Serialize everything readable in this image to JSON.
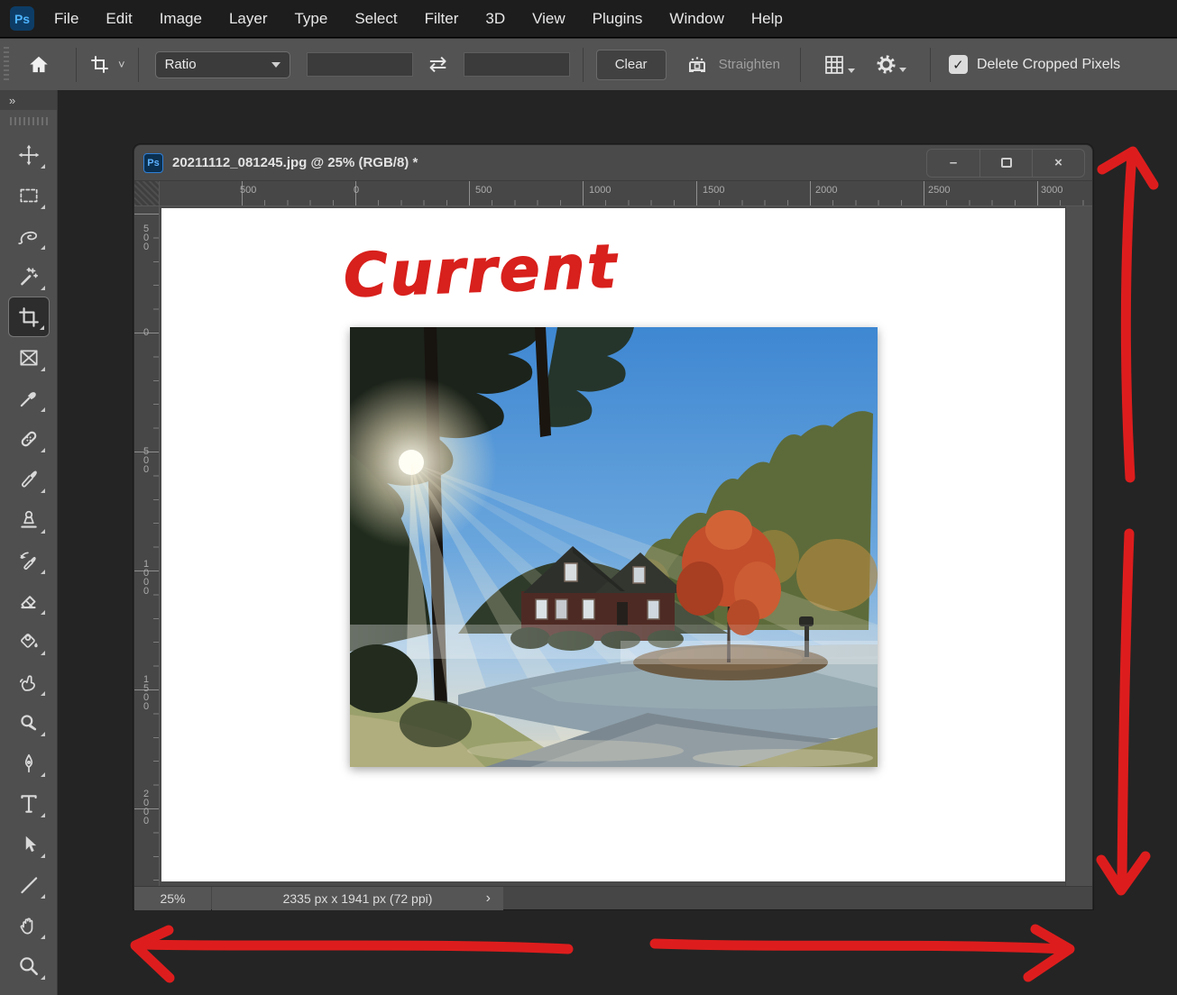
{
  "app": {
    "logo": "Ps",
    "theme_bg": "#242424",
    "panel_bg": "#535353",
    "annotation_color": "#dd1d1d"
  },
  "menubar": {
    "items": [
      "File",
      "Edit",
      "Image",
      "Layer",
      "Type",
      "Select",
      "Filter",
      "3D",
      "View",
      "Plugins",
      "Window",
      "Help"
    ]
  },
  "optionsbar": {
    "ratio_label": "Ratio",
    "width_value": "",
    "height_value": "",
    "swap_glyph": "⇄",
    "clear_label": "Clear",
    "straighten_label": "Straighten",
    "check_glyph": "✓",
    "delete_cropped_label": "Delete Cropped Pixels",
    "delete_cropped_checked": true,
    "icons": [
      "home-icon",
      "crop-tool-icon",
      "swap-icon",
      "straighten-icon",
      "grid-overlay-icon",
      "gear-icon",
      "checkbox"
    ]
  },
  "toolbar": {
    "expand_glyph": "»",
    "selected_tool": "crop",
    "tools": [
      "move",
      "rectangular-marquee",
      "lasso",
      "magic-wand",
      "crop",
      "frame",
      "eyedropper",
      "spot-healing-brush",
      "brush",
      "clone-stamp",
      "history-brush",
      "eraser",
      "paint-bucket",
      "smudge",
      "dodge",
      "pen",
      "type",
      "path-selection",
      "line",
      "hand",
      "zoom"
    ]
  },
  "document": {
    "title": "20211112_081245.jpg @ 25% (RGB/8) *",
    "window_buttons": {
      "minimize": "–",
      "close": "×"
    },
    "status": {
      "zoom": "25%",
      "dimensions": "2335 px x 1941 px (72 ppi)",
      "chevron": "›"
    }
  },
  "rulers": {
    "horizontal": [
      "500",
      "0",
      "500",
      "1000",
      "1500",
      "2000",
      "2500",
      "3000"
    ],
    "vertical": [
      "500",
      "0",
      "500",
      "1000",
      "1500",
      "2000"
    ]
  },
  "annotation": {
    "label": "Current",
    "color": "#d8201c"
  },
  "photo": {
    "subject": "sunrise-through-pines-brick-house-red-maple",
    "palette": {
      "sky": "#3e87d2",
      "pines": "#1c231a",
      "house": "#4e2a24",
      "maple": "#c24e2c",
      "road": "#8da0ab",
      "frost_grass": "#b0ad7e"
    }
  }
}
